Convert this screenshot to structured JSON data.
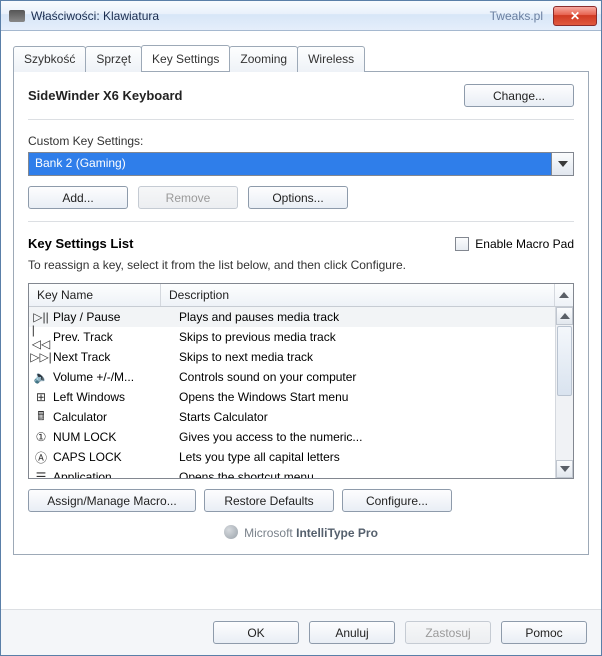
{
  "title": "Właściwości: Klawiatura",
  "watermark": "Tweaks.pl",
  "tabs": [
    {
      "label": "Szybkość"
    },
    {
      "label": "Sprzęt"
    },
    {
      "label": "Key Settings"
    },
    {
      "label": "Zooming"
    },
    {
      "label": "Wireless"
    }
  ],
  "keyboard_name": "SideWinder X6 Keyboard",
  "change_btn": "Change...",
  "cks_label": "Custom Key Settings:",
  "cks_value": "Bank 2 (Gaming)",
  "add_btn": "Add...",
  "remove_btn": "Remove",
  "options_btn": "Options...",
  "ksl_title": "Key Settings List",
  "enable_macro": "Enable Macro Pad",
  "instr": "To reassign a key, select it from the list below, and then click Configure.",
  "col_name": "Key Name",
  "col_desc": "Description",
  "rows": [
    {
      "icon": "play-pause-icon",
      "glyph": "▷||",
      "name": "Play / Pause",
      "desc": "Plays and pauses media track"
    },
    {
      "icon": "prev-track-icon",
      "glyph": "|◁◁",
      "name": "Prev. Track",
      "desc": "Skips to previous media track"
    },
    {
      "icon": "next-track-icon",
      "glyph": "▷▷|",
      "name": "Next Track",
      "desc": "Skips to next media track"
    },
    {
      "icon": "volume-icon",
      "glyph": "🔈",
      "name": "Volume +/-/M...",
      "desc": "Controls sound on your computer"
    },
    {
      "icon": "windows-icon",
      "glyph": "⊞",
      "name": "Left Windows",
      "desc": "Opens the Windows Start menu"
    },
    {
      "icon": "calculator-icon",
      "glyph": "🖩",
      "name": "Calculator",
      "desc": "Starts Calculator"
    },
    {
      "icon": "numlock-icon",
      "glyph": "①",
      "name": "NUM LOCK",
      "desc": "Gives you access to the numeric..."
    },
    {
      "icon": "capslock-icon",
      "glyph": "Ⓐ",
      "name": "CAPS LOCK",
      "desc": "Lets you type all capital letters"
    },
    {
      "icon": "application-icon",
      "glyph": "☰",
      "name": "Application",
      "desc": "Opens the shortcut menu"
    }
  ],
  "assign_btn": "Assign/Manage Macro...",
  "restore_btn": "Restore Defaults",
  "configure_btn": "Configure...",
  "brand_prefix": "Microsoft ",
  "brand_strong": "IntelliType Pro",
  "ok": "OK",
  "cancel": "Anuluj",
  "apply": "Zastosuj",
  "help": "Pomoc"
}
